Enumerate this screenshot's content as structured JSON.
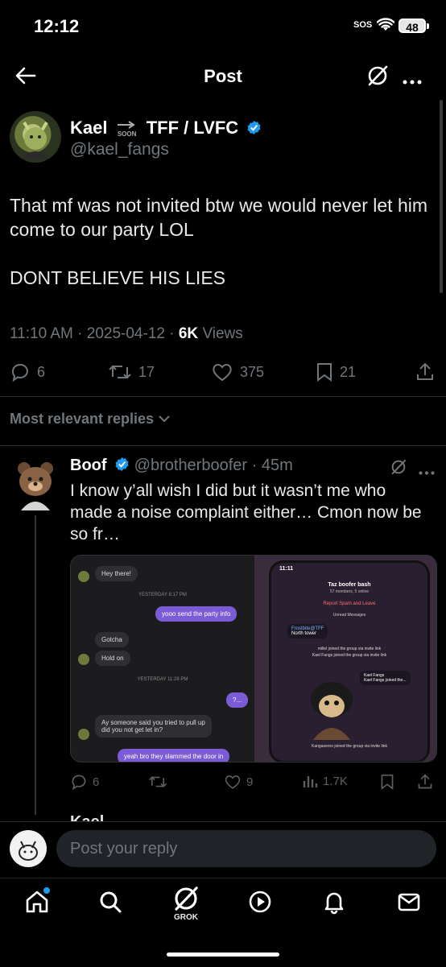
{
  "status_bar": {
    "time": "12:12",
    "sos": "SOS",
    "battery": "48"
  },
  "nav": {
    "title": "Post"
  },
  "post": {
    "author_name": "Kael",
    "author_soon": "SOON",
    "author_suffix": "TFF / LVFC",
    "handle": "@kael_fangs",
    "text": "That mf was not invited btw we would never let him come to our party LOL\n\nDONT BELIEVE HIS LIES",
    "time": "11:10 AM",
    "date": "2025-04-12",
    "views_count": "6K",
    "views_label": "Views",
    "replies": "6",
    "reposts": "17",
    "likes": "375",
    "bookmarks": "21"
  },
  "filter": {
    "label": "Most relevant replies"
  },
  "reply": {
    "name": "Boof",
    "handle": "@brotherboofer",
    "age": "45m",
    "text": "I know y’all wish I did but it wasn’t me who made a noise complaint either… Cmon now be so fr…",
    "replies": "6",
    "likes": "9",
    "views": "1.7K",
    "media": {
      "left": {
        "hey": "Hey there!",
        "sys1": "YESTERDAY 8:17 PM",
        "send": "yooo send the party info",
        "gotcha": "Gotcha",
        "holdon": "Hold on",
        "sys2": "YESTERDAY 11:28 PM",
        "q": "?...",
        "ay": "Ay someone said you tried to pull up\ndid you not get let in?",
        "slam": "yeah bro they slammed the door in"
      },
      "right": {
        "time": "11:11",
        "group": "Taz boofer bash",
        "members": "57 members, 5 online",
        "report": "Report Spam and Leave",
        "unread": "Unread Messages",
        "sender": "Frostbite@TFF",
        "msg": "North tower",
        "joined1": "millel joined the group via invite link",
        "joined2": "Kael Fangs joined the group via invite link",
        "kael": "Kael Fangs",
        "kael_joined": "Kael Fangs joined the...",
        "joined3": "Kangaseroo joined the group via invite link"
      }
    }
  },
  "next_reply_partial": {
    "name": "Kael"
  },
  "composer": {
    "placeholder": "Post your reply"
  },
  "tabbar": {
    "grok_label": "GROK"
  },
  "colors": {
    "accent": "#1d9bf0",
    "text": "#e7e9ea",
    "muted": "#71767b",
    "bg": "#000000"
  }
}
